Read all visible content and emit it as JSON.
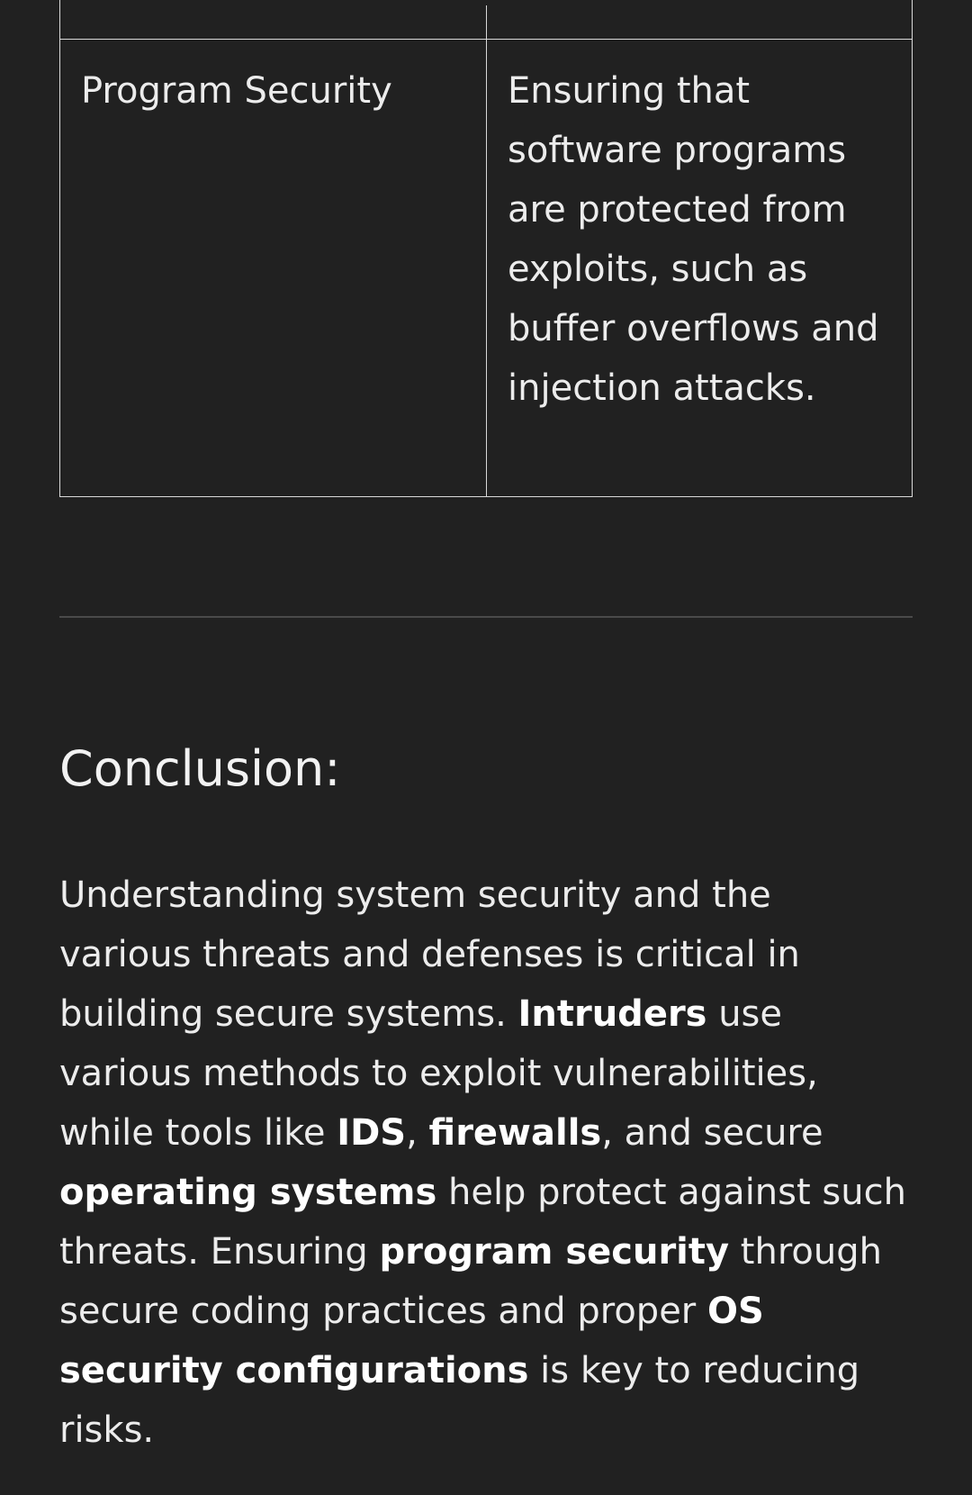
{
  "table": {
    "row": {
      "term": "Program Security",
      "description": "Ensuring that software programs are protected from exploits, such as buffer overflows and injection attacks."
    }
  },
  "conclusion": {
    "heading": "Conclusion:",
    "segments": [
      "Understanding system security and the various threats and defenses is critical in building secure systems. ",
      "Intruders",
      " use various methods to exploit vulnerabilities, while tools like ",
      "IDS",
      ", ",
      "firewalls",
      ", and secure ",
      "operating systems",
      " help protect against such threats. Ensuring ",
      "program security",
      " through secure coding practices and proper ",
      "OS security configurations",
      " is key to reducing risks."
    ]
  }
}
